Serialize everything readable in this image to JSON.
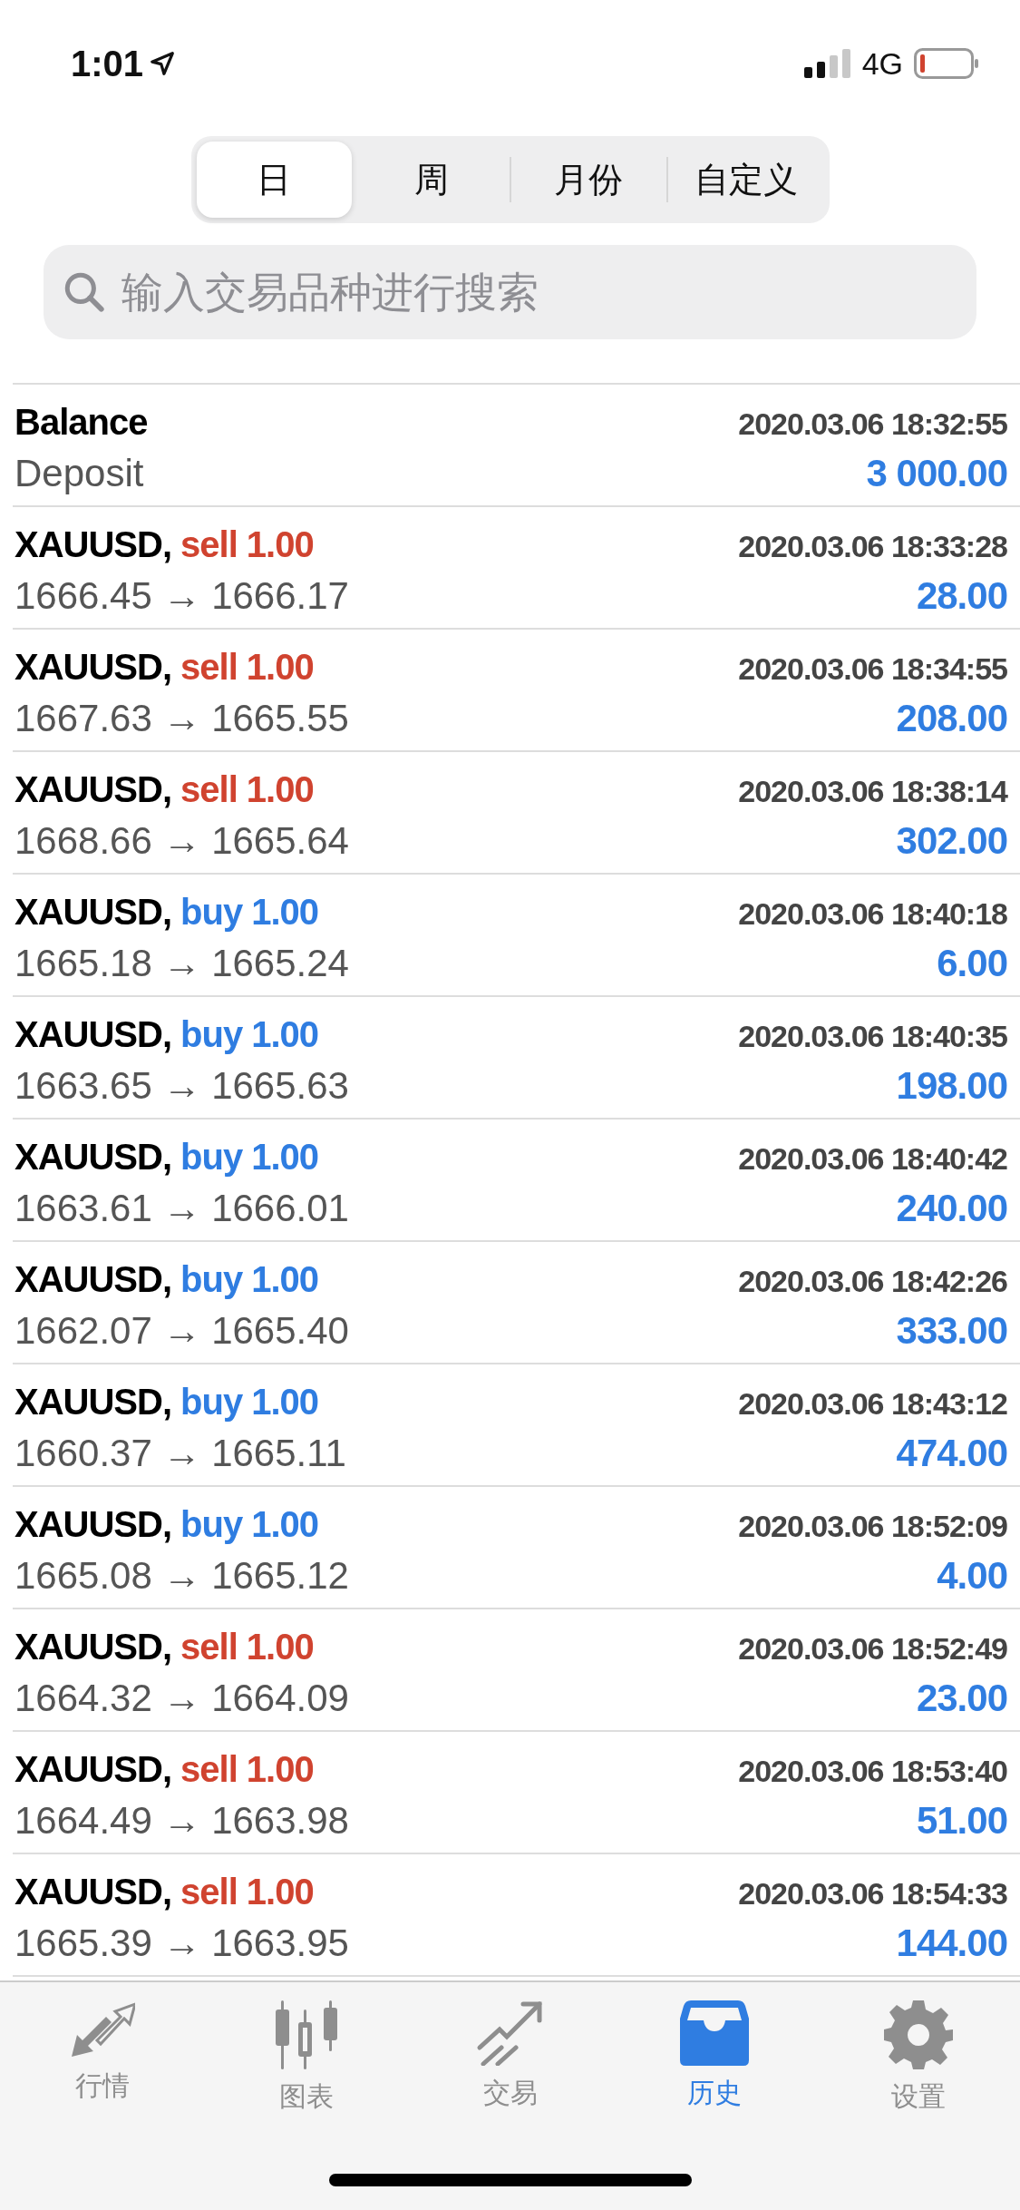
{
  "status_bar": {
    "time": "1:01",
    "network": "4G"
  },
  "period_tabs": [
    {
      "label": "日",
      "selected": true
    },
    {
      "label": "周",
      "selected": false
    },
    {
      "label": "月份",
      "selected": false
    },
    {
      "label": "自定义",
      "selected": false
    }
  ],
  "search": {
    "placeholder": "输入交易品种进行搜索"
  },
  "deals": [
    {
      "kind": "balance",
      "title": "Balance",
      "time": "2020.03.06 18:32:55",
      "detail": "Deposit",
      "amount": "3 000.00"
    },
    {
      "kind": "trade",
      "title": "XAUUSD,",
      "side": "sell",
      "volume": "1.00",
      "time": "2020.03.06 18:33:28",
      "detail": "1666.45 → 1666.17",
      "amount": "28.00"
    },
    {
      "kind": "trade",
      "title": "XAUUSD,",
      "side": "sell",
      "volume": "1.00",
      "time": "2020.03.06 18:34:55",
      "detail": "1667.63 → 1665.55",
      "amount": "208.00"
    },
    {
      "kind": "trade",
      "title": "XAUUSD,",
      "side": "sell",
      "volume": "1.00",
      "time": "2020.03.06 18:38:14",
      "detail": "1668.66 → 1665.64",
      "amount": "302.00"
    },
    {
      "kind": "trade",
      "title": "XAUUSD,",
      "side": "buy",
      "volume": "1.00",
      "time": "2020.03.06 18:40:18",
      "detail": "1665.18 → 1665.24",
      "amount": "6.00"
    },
    {
      "kind": "trade",
      "title": "XAUUSD,",
      "side": "buy",
      "volume": "1.00",
      "time": "2020.03.06 18:40:35",
      "detail": "1663.65 → 1665.63",
      "amount": "198.00"
    },
    {
      "kind": "trade",
      "title": "XAUUSD,",
      "side": "buy",
      "volume": "1.00",
      "time": "2020.03.06 18:40:42",
      "detail": "1663.61 → 1666.01",
      "amount": "240.00"
    },
    {
      "kind": "trade",
      "title": "XAUUSD,",
      "side": "buy",
      "volume": "1.00",
      "time": "2020.03.06 18:42:26",
      "detail": "1662.07 → 1665.40",
      "amount": "333.00"
    },
    {
      "kind": "trade",
      "title": "XAUUSD,",
      "side": "buy",
      "volume": "1.00",
      "time": "2020.03.06 18:43:12",
      "detail": "1660.37 → 1665.11",
      "amount": "474.00"
    },
    {
      "kind": "trade",
      "title": "XAUUSD,",
      "side": "buy",
      "volume": "1.00",
      "time": "2020.03.06 18:52:09",
      "detail": "1665.08 → 1665.12",
      "amount": "4.00"
    },
    {
      "kind": "trade",
      "title": "XAUUSD,",
      "side": "sell",
      "volume": "1.00",
      "time": "2020.03.06 18:52:49",
      "detail": "1664.32 → 1664.09",
      "amount": "23.00"
    },
    {
      "kind": "trade",
      "title": "XAUUSD,",
      "side": "sell",
      "volume": "1.00",
      "time": "2020.03.06 18:53:40",
      "detail": "1664.49 → 1663.98",
      "amount": "51.00"
    },
    {
      "kind": "trade",
      "title": "XAUUSD,",
      "side": "sell",
      "volume": "1.00",
      "time": "2020.03.06 18:54:33",
      "detail": "1665.39 → 1663.95",
      "amount": "144.00"
    }
  ],
  "tab_bar": [
    {
      "label": "行情",
      "selected": false
    },
    {
      "label": "图表",
      "selected": false
    },
    {
      "label": "交易",
      "selected": false
    },
    {
      "label": "历史",
      "selected": true
    },
    {
      "label": "设置",
      "selected": false
    }
  ]
}
